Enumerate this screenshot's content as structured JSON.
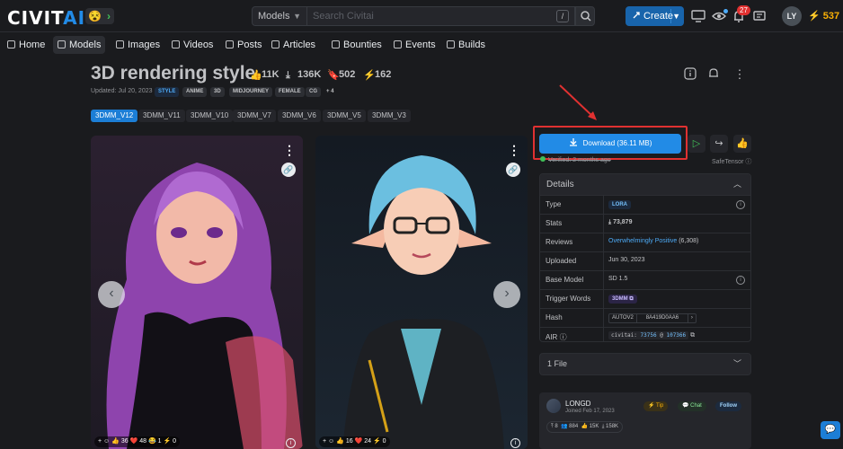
{
  "brand": {
    "logo_main": "CIVIT",
    "logo_ai": "AI"
  },
  "header": {
    "emoji": "😵",
    "search_scope": "Models",
    "search_placeholder": "Search Civitai",
    "search_shortcut": "/",
    "create_label": "Create",
    "notification_count": "27",
    "avatar_initials": "LY",
    "buzz_amount": "537"
  },
  "nav": {
    "items": [
      {
        "label": "Home"
      },
      {
        "label": "Models"
      },
      {
        "label": "Images"
      },
      {
        "label": "Videos"
      },
      {
        "label": "Posts"
      },
      {
        "label": "Articles"
      },
      {
        "label": "Bounties"
      },
      {
        "label": "Events"
      },
      {
        "label": "Builds"
      }
    ],
    "active": "Models"
  },
  "model": {
    "title": "3D rendering style",
    "likes": "11K",
    "downloads": "136K",
    "collections": "502",
    "buzz": "162",
    "updated": "Updated: Jul 20, 2023",
    "tags": [
      "STYLE",
      "ANIME",
      "3D",
      "MIDJOURNEY",
      "FEMALE",
      "CG",
      "+ 4"
    ],
    "versions": [
      "3DMM_V12",
      "3DMM_V11",
      "3DMM_V10",
      "3DMM_V7",
      "3DMM_V6",
      "3DMM_V5",
      "3DMM_V3"
    ],
    "active_version": "3DMM_V12"
  },
  "gallery": {
    "card1": {
      "reactions": [
        "+",
        "☺",
        "👍 36",
        "❤️ 48",
        "😂 1",
        "⚡ 0"
      ]
    },
    "card2": {
      "reactions": [
        "+",
        "☺",
        "👍 16",
        "❤️ 24",
        "⚡ 0"
      ]
    }
  },
  "download": {
    "label": "Download (36.11 MB)",
    "verified": "Verified: 2 months ago",
    "safetensor": "SafeTensor"
  },
  "details": {
    "heading": "Details",
    "rows": [
      {
        "label": "Type",
        "value": "LORA"
      },
      {
        "label": "Stats",
        "value": "73,879"
      },
      {
        "label": "Reviews",
        "value": "Overwhelmingly Positive",
        "extra": "(6,308)"
      },
      {
        "label": "Uploaded",
        "value": "Jun 30, 2023"
      },
      {
        "label": "Base Model",
        "value": "SD 1.5"
      },
      {
        "label": "Trigger Words",
        "value": "3DMM"
      },
      {
        "label": "Hash",
        "value": "AUTOV2",
        "hash": "8A419D0AA6"
      },
      {
        "label": "AIR",
        "value": "civitai:",
        "air_model": "73756",
        "air_at": "@",
        "air_version": "107366"
      }
    ]
  },
  "files": {
    "label": "1 File"
  },
  "creator": {
    "name": "LONGD",
    "joined": "Joined Feb 17, 2023",
    "tip_label": "Tip",
    "chat_label": "Chat",
    "follow_label": "Follow",
    "stats": [
      "8",
      "884",
      "15K",
      "158K"
    ]
  },
  "colors": {
    "accent": "#228be6",
    "background": "#1a1b1e",
    "annotation_red": "#e03131",
    "buzz": "#fab005"
  }
}
